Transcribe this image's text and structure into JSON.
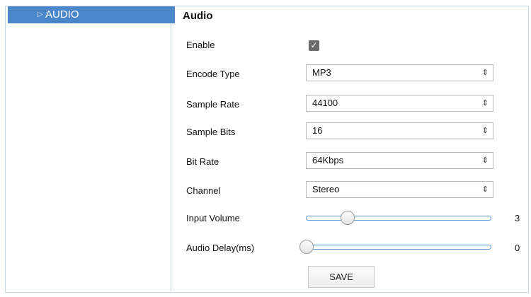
{
  "sidebar": {
    "items": [
      {
        "label": "AUDIO",
        "icon": "triangle-right-icon",
        "selected": true
      }
    ]
  },
  "main": {
    "title": "Audio",
    "enable": {
      "label": "Enable",
      "checked": true
    },
    "encode_type": {
      "label": "Encode Type",
      "value": "MP3"
    },
    "sample_rate": {
      "label": "Sample Rate",
      "value": "44100"
    },
    "sample_bits": {
      "label": "Sample Bits",
      "value": "16"
    },
    "bit_rate": {
      "label": "Bit Rate",
      "value": "64Kbps"
    },
    "channel": {
      "label": "Channel",
      "value": "Stereo"
    },
    "input_volume": {
      "label": "Input Volume",
      "value": "3",
      "position": 0.22
    },
    "audio_delay": {
      "label": "Audio Delay(ms)",
      "value": "0",
      "position": 0.0
    },
    "save_label": "SAVE"
  },
  "colors": {
    "nav_selected_bg": "#4a86c8",
    "border": "#c9d6e6",
    "slider_track": "#5b9bd5"
  }
}
